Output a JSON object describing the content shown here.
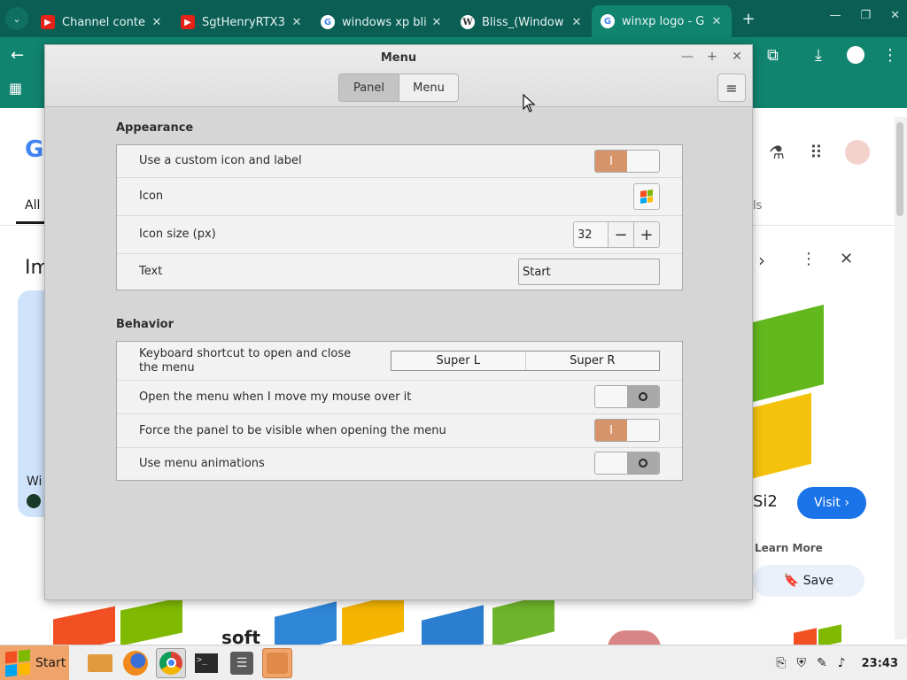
{
  "browser": {
    "tabs": [
      {
        "title": "Channel conte",
        "favicon": "youtube-icon"
      },
      {
        "title": "SgtHenryRTX3",
        "favicon": "youtube-icon"
      },
      {
        "title": "windows xp bli",
        "favicon": "google-icon"
      },
      {
        "title": "Bliss_(Window",
        "favicon": "wikimedia-icon"
      },
      {
        "title": "winxp logo - G",
        "favicon": "google-icon",
        "active": true
      }
    ],
    "page": {
      "tab_all": "All",
      "tab_tools_fragment": "ls",
      "heading_fragment": "Im",
      "caption_fragment": "Wi",
      "brand_fragment": "Si2",
      "visit_label": "Visit",
      "learn_more": "Learn More",
      "save_label": "Save",
      "soft_fragment": "soft"
    }
  },
  "dialog": {
    "title": "Menu",
    "tabs": [
      {
        "label": "Panel",
        "active": true
      },
      {
        "label": "Menu",
        "active": false
      }
    ],
    "appearance": {
      "heading": "Appearance",
      "custom_icon_label": "Use a custom icon and label",
      "custom_icon_state": "I",
      "icon_label": "Icon",
      "icon_size_label": "Icon size (px)",
      "icon_size_value": "32",
      "text_label": "Text",
      "text_value": "Start"
    },
    "behavior": {
      "heading": "Behavior",
      "shortcut_label": "Keyboard shortcut to open and close the menu",
      "shortcut_primary": "Super L",
      "shortcut_secondary": "Super R",
      "hover_open_label": "Open the menu when I move my mouse over it",
      "force_panel_label": "Force the panel to be visible when opening the menu",
      "force_panel_state": "I",
      "animations_label": "Use menu animations"
    }
  },
  "taskbar": {
    "start_label": "Start",
    "clock": "23:43"
  },
  "colors": {
    "browser_frame": "#0b5e54",
    "toolbar": "#10846f",
    "switch_on": "#d5946a",
    "start_button": "#f0a46a",
    "visit_button": "#1a73e8"
  }
}
